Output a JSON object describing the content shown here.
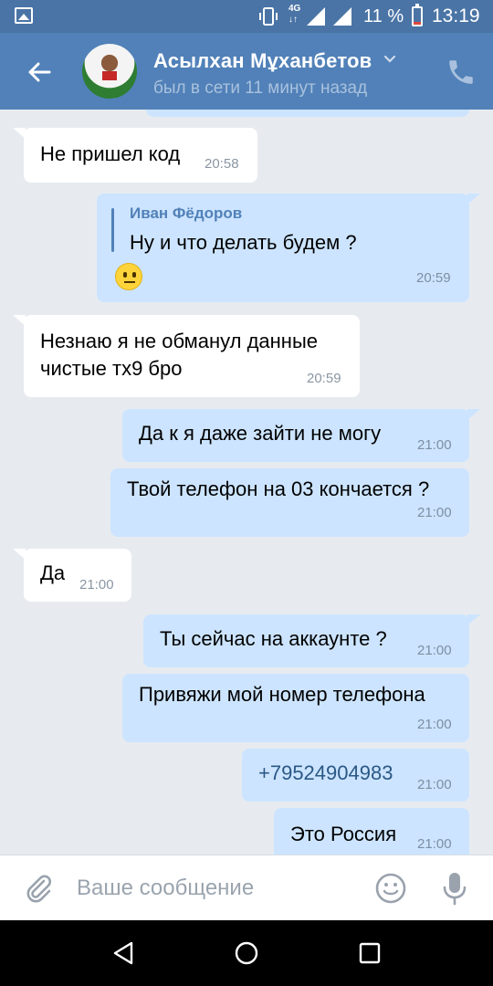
{
  "status_bar": {
    "network": "4G",
    "network_arrows": "↓↑",
    "battery": "11 %",
    "time": "13:19"
  },
  "header": {
    "name": "Асылхан Мұханбетов",
    "status": "был в сети 11 минут назад"
  },
  "messages": [
    {
      "direction": "in",
      "text": "Не пришел код",
      "time": "20:58"
    },
    {
      "direction": "out",
      "reply_author": "Иван Фёдоров",
      "text": "Ну и что делать будем ?",
      "emoji": "neutral-face",
      "time": "20:59"
    },
    {
      "direction": "in",
      "text": "Незнаю я не обманул данные",
      "text2": "чистые тх9 бро",
      "time": "20:59"
    },
    {
      "direction": "out",
      "text": "Да к я даже зайти не могу",
      "time": "21:00"
    },
    {
      "direction": "out",
      "text": "Твой телефон на 03 кончается ?",
      "time": "21:00"
    },
    {
      "direction": "in",
      "text": "Да",
      "time": "21:00"
    },
    {
      "direction": "out",
      "text": "Ты сейчас на аккаунте ?",
      "time": "21:00"
    },
    {
      "direction": "out",
      "text": "Привяжи мой номер телефона",
      "time": "21:00"
    },
    {
      "direction": "out",
      "text": "+79524904983",
      "time": "21:00",
      "is_link": true
    },
    {
      "direction": "out",
      "text": "Это Россия",
      "time": "21:00"
    }
  ],
  "composer": {
    "placeholder": "Ваше сообщение"
  },
  "colors": {
    "header": "#5181b8",
    "status_bar": "#4a74a5",
    "background": "#e7ebf0",
    "outgoing": "#cce4ff",
    "incoming": "#ffffff",
    "link": "#2a5885"
  }
}
